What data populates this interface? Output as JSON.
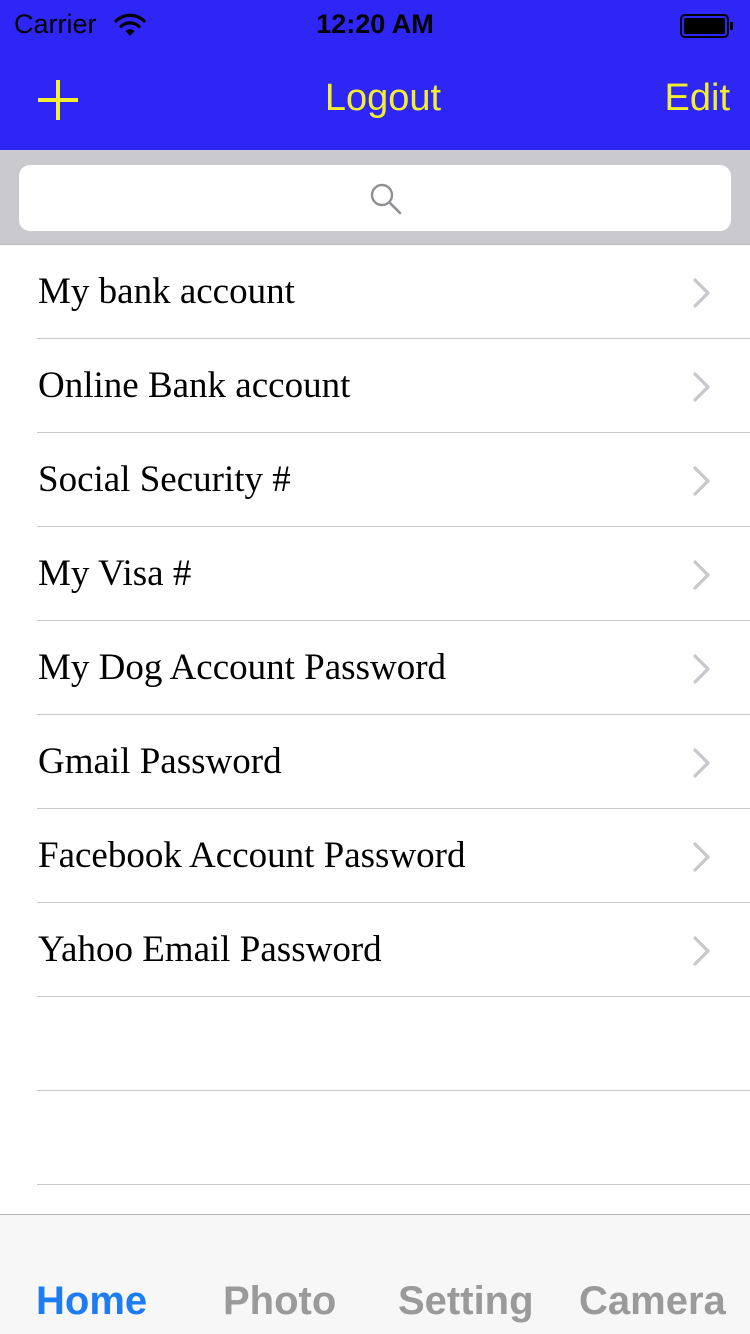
{
  "status_bar": {
    "carrier": "Carrier",
    "time": "12:20 AM"
  },
  "nav_bar": {
    "title": "Logout",
    "edit_label": "Edit",
    "background_color": "#2d26f5",
    "tint_color": "#f4ef2e"
  },
  "search": {
    "placeholder": ""
  },
  "list": {
    "items": [
      {
        "label": "My bank account"
      },
      {
        "label": "Online Bank account"
      },
      {
        "label": "Social Security #"
      },
      {
        "label": "My Visa #"
      },
      {
        "label": "My Dog Account Password"
      },
      {
        "label": "Gmail Password"
      },
      {
        "label": "Facebook Account Password"
      },
      {
        "label": "Yahoo Email Password"
      }
    ]
  },
  "tab_bar": {
    "active_color": "#1e7cf2",
    "tabs": [
      {
        "label": "Home",
        "active": true
      },
      {
        "label": "Photo",
        "active": false
      },
      {
        "label": "Setting",
        "active": false
      },
      {
        "label": "Camera",
        "active": false
      }
    ]
  }
}
